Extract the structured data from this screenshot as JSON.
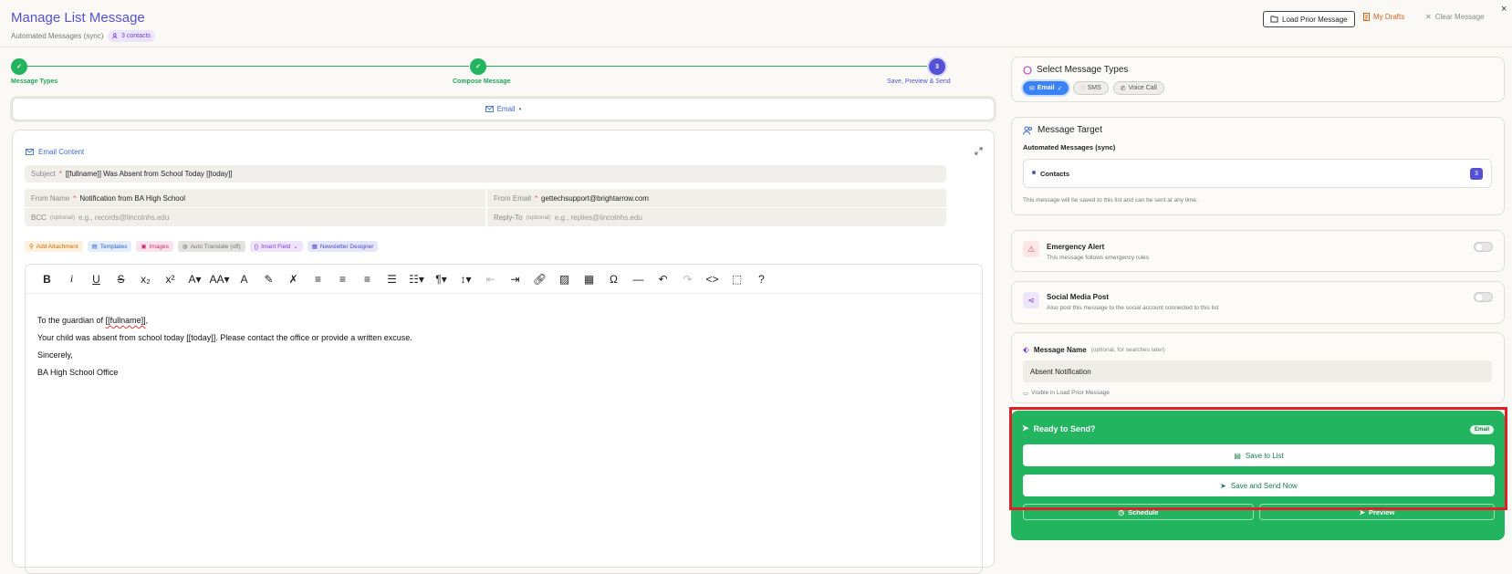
{
  "header": {
    "title": "Manage List Message",
    "subtitle": "Automated Messages (sync)",
    "contacts_badge": "3 contacts",
    "load_prior": "Load Prior Message",
    "my_drafts": "My Drafts",
    "clear": "Clear Message",
    "close": "×"
  },
  "stepper": {
    "steps": [
      {
        "label": "Message Types",
        "state": "done"
      },
      {
        "label": "Compose Message",
        "state": "done"
      },
      {
        "label": "Save, Preview & Send",
        "state": "current",
        "number": "3"
      }
    ]
  },
  "tabs": {
    "email": "Email"
  },
  "editor": {
    "section_title": "Email Content",
    "subject_label": "Subject",
    "subject_value": "[[fullname]] Was Absent from School Today [[today]]",
    "from_name_label": "From Name",
    "from_name_value": "Notification from BA High School",
    "from_email_label": "From Email",
    "from_email_value": "gettechsupport@brightarrow.com",
    "bcc_label": "BCC",
    "bcc_optional": "(optional)",
    "bcc_placeholder": "e.g., records@lincolnhs.edu",
    "replyto_label": "Reply-To",
    "replyto_optional": "(optional)",
    "replyto_placeholder": "e.g., replies@lincolnhs.edu",
    "chips": {
      "attach": "Add Attachment",
      "templates": "Templates",
      "images": "Images",
      "translate": "Auto Translate (off)",
      "insert": "Insert Field",
      "newsletter": "Newsletter Designer"
    },
    "body": {
      "line1_pre": "To the guardian of ",
      "line1_field": "[[fullname]]",
      "line1_post": ",",
      "line2": "Your child was absent from school today [[today]]. Please contact the office or provide a written excuse.",
      "line3": "Sincerely,",
      "line4": "BA High School Office"
    }
  },
  "right": {
    "types": {
      "title": "Select Message Types",
      "email": "Email",
      "sms": "SMS",
      "voice": "Voice Call"
    },
    "target": {
      "title": "Message Target",
      "list_name": "Automated Messages (sync)",
      "contacts_label": "Contacts",
      "contacts_count": "3",
      "note": "This message will be saved to this list and can be sent at any time."
    },
    "emergency": {
      "title": "Emergency Alert",
      "desc": "This message follows emergency rules",
      "enabled": false
    },
    "social": {
      "title": "Social Media Post",
      "desc": "Also post this message to the social account connected to this list",
      "enabled": false
    },
    "name": {
      "title": "Message Name",
      "hint": "(optional, for searches later)",
      "value": "Absent Notification",
      "visible_note": "Visible in Load Prior Message"
    },
    "send": {
      "title": "Ready to Send?",
      "badge": "Email",
      "save_list": "Save to List",
      "save_send": "Save and Send Now",
      "schedule": "Schedule",
      "preview": "Preview"
    }
  },
  "colors": {
    "accent": "#5551d6",
    "green": "#22b45e",
    "highlight": "#e01f26"
  }
}
